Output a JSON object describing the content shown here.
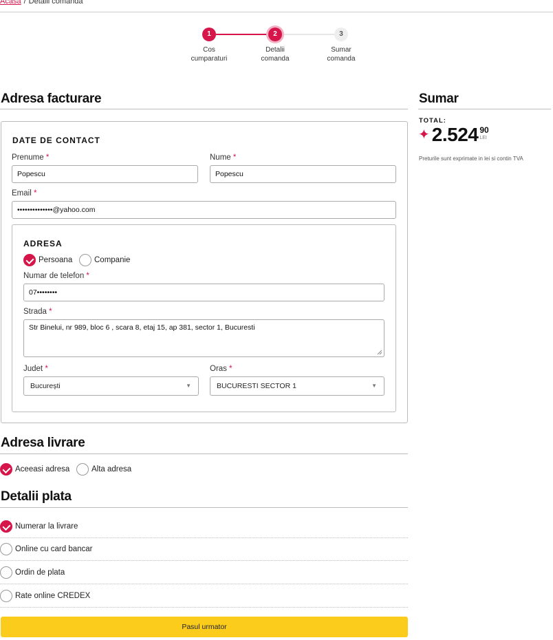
{
  "breadcrumb": {
    "home": "Acasa",
    "separator": "/",
    "current": "Detalii comanda"
  },
  "stepper": {
    "steps": [
      {
        "number": "1",
        "label_line1": "Cos",
        "label_line2": "cumparaturi",
        "state": "done"
      },
      {
        "number": "2",
        "label_line1": "Detalii",
        "label_line2": "comanda",
        "state": "active"
      },
      {
        "number": "3",
        "label_line1": "Sumar",
        "label_line2": "comanda",
        "state": "todo"
      }
    ]
  },
  "billing": {
    "title": "Adresa facturare",
    "contact": {
      "title": "DATE DE CONTACT",
      "first_name_label": "Prenume",
      "first_name_value": "Popescu",
      "last_name_label": "Nume",
      "last_name_value": "Popescu",
      "email_label": "Email",
      "email_value": "••••••••••••••@yahoo.com"
    },
    "address": {
      "title": "ADRESA",
      "type_person": "Persoana",
      "type_company": "Companie",
      "selected_type": "Persoana",
      "phone_label": "Numar de telefon",
      "phone_value": "07••••••••",
      "street_label": "Strada",
      "street_value": "Str Binelui, nr 989, bloc 6 , scara 8, etaj 15, ap 381, sector 1, Bucuresti",
      "county_label": "Judet",
      "county_value": "București",
      "city_label": "Oras",
      "city_value": "BUCURESTI SECTOR 1"
    }
  },
  "shipping": {
    "title": "Adresa livrare",
    "same_address": "Aceeasi adresa",
    "other_address": "Alta adresa",
    "selected": "Aceeasi adresa"
  },
  "payment": {
    "title": "Detalii plata",
    "options": [
      "Numerar la livrare",
      "Online cu card bancar",
      "Ordin de plata",
      "Rate online CREDEX"
    ],
    "selected": "Numerar la livrare"
  },
  "next_button": "Pasul urmator",
  "summary": {
    "title": "Sumar",
    "total_label": "TOTAL:",
    "total_int": "2.524",
    "total_cents": "90",
    "currency": "LEI",
    "vat_note": "Preturile sunt exprimate in lei si contin TVA"
  },
  "colors": {
    "accent": "#d6164b",
    "button": "#fccc1d"
  },
  "icons": {
    "selected_radio": "check-icon",
    "dropdown": "chevron-down-icon",
    "price_marker": "star-icon"
  }
}
